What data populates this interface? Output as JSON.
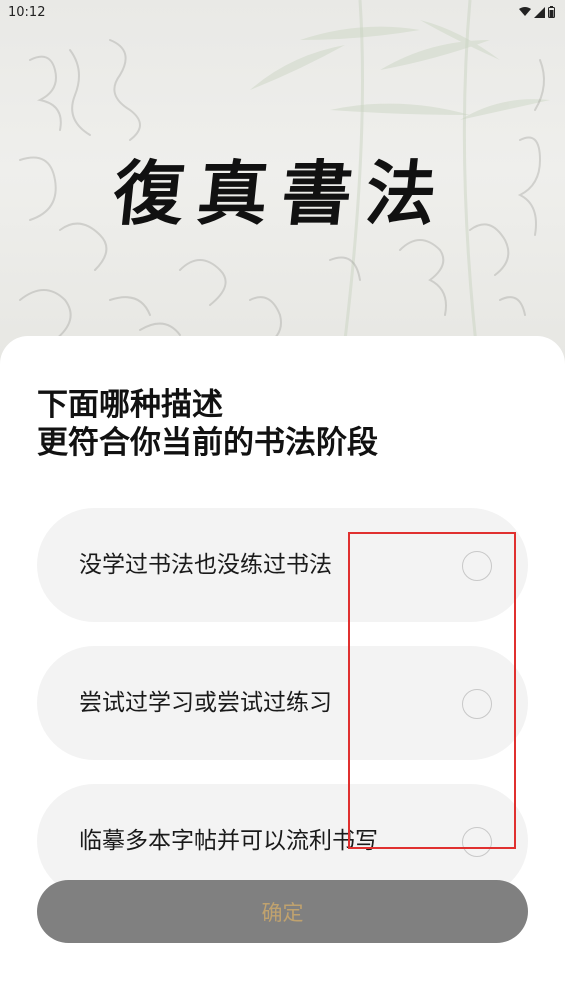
{
  "status_bar": {
    "time": "10:12"
  },
  "app": {
    "title": "復真書法"
  },
  "question": {
    "line1": "下面哪种描述",
    "line2": "更符合你当前的书法阶段"
  },
  "options": [
    {
      "label": "没学过书法也没练过书法",
      "selected": false
    },
    {
      "label": "尝试过学习或尝试过练习",
      "selected": false
    },
    {
      "label": "临摹多本字帖并可以流利书写",
      "selected": false
    }
  ],
  "confirm": {
    "label": "确定",
    "enabled": false
  },
  "colors": {
    "button_bg": "#808080",
    "button_text": "#c0a26e",
    "option_bg": "#f3f3f3",
    "annotation": "#e0302f"
  }
}
